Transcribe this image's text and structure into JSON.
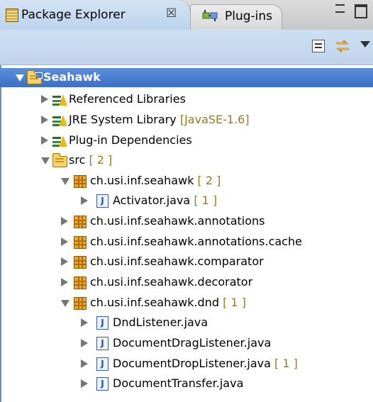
{
  "tabs": {
    "package_explorer": {
      "label": "Package Explorer",
      "close_glyph": "☒",
      "icon": "package-explorer-icon"
    },
    "plugins": {
      "label": "Plug-ins",
      "icon": "plugins-icon"
    }
  },
  "window_controls": {
    "minimize_icon": "minimize-icon",
    "maximize_icon": "maximize-icon"
  },
  "toolbar": {
    "collapse_all_icon": "collapse-all-icon",
    "link_editor_icon": "link-with-editor-icon",
    "view_menu_icon": "view-menu-icon"
  },
  "colors": {
    "selection": "#3b6fc9",
    "decoration": "#9a7a20",
    "view_toolbar": "#c6d9ee"
  },
  "tree": [
    {
      "label": "Seahawk",
      "decoration": "",
      "icon": "project-folder-icon",
      "expanded": true,
      "selected": true
    },
    {
      "label": "Referenced Libraries",
      "decoration": "",
      "icon": "library-icon",
      "expanded": false
    },
    {
      "label": "JRE System Library",
      "decoration": "[JavaSE-1.6]",
      "icon": "library-icon",
      "expanded": false
    },
    {
      "label": "Plug-in Dependencies",
      "decoration": "",
      "icon": "library-icon",
      "expanded": false
    },
    {
      "label": "src",
      "decoration": "[ 2 ]",
      "icon": "source-folder-icon",
      "expanded": true
    },
    {
      "label": "ch.usi.inf.seahawk",
      "decoration": "[ 2 ]",
      "icon": "package-icon",
      "expanded": true
    },
    {
      "label": "Activator.java",
      "decoration": "[ 1 ]",
      "icon": "java-file-icon",
      "expanded": false
    },
    {
      "label": "ch.usi.inf.seahawk.annotations",
      "decoration": "",
      "icon": "package-icon",
      "expanded": false
    },
    {
      "label": "ch.usi.inf.seahawk.annotations.cache",
      "decoration": "",
      "icon": "package-icon",
      "expanded": false
    },
    {
      "label": "ch.usi.inf.seahawk.comparator",
      "decoration": "",
      "icon": "package-icon",
      "expanded": false
    },
    {
      "label": "ch.usi.inf.seahawk.decorator",
      "decoration": "",
      "icon": "package-icon",
      "expanded": false
    },
    {
      "label": "ch.usi.inf.seahawk.dnd",
      "decoration": "[ 1 ]",
      "icon": "package-icon",
      "expanded": true
    },
    {
      "label": "DndListener.java",
      "decoration": "",
      "icon": "java-file-icon",
      "expanded": false
    },
    {
      "label": "DocumentDragListener.java",
      "decoration": "",
      "icon": "java-file-icon",
      "expanded": false
    },
    {
      "label": "DocumentDropListener.java",
      "decoration": "[ 1 ]",
      "icon": "java-file-icon",
      "expanded": false
    },
    {
      "label": "DocumentTransfer.java",
      "decoration": "",
      "icon": "java-file-icon",
      "expanded": false
    }
  ]
}
